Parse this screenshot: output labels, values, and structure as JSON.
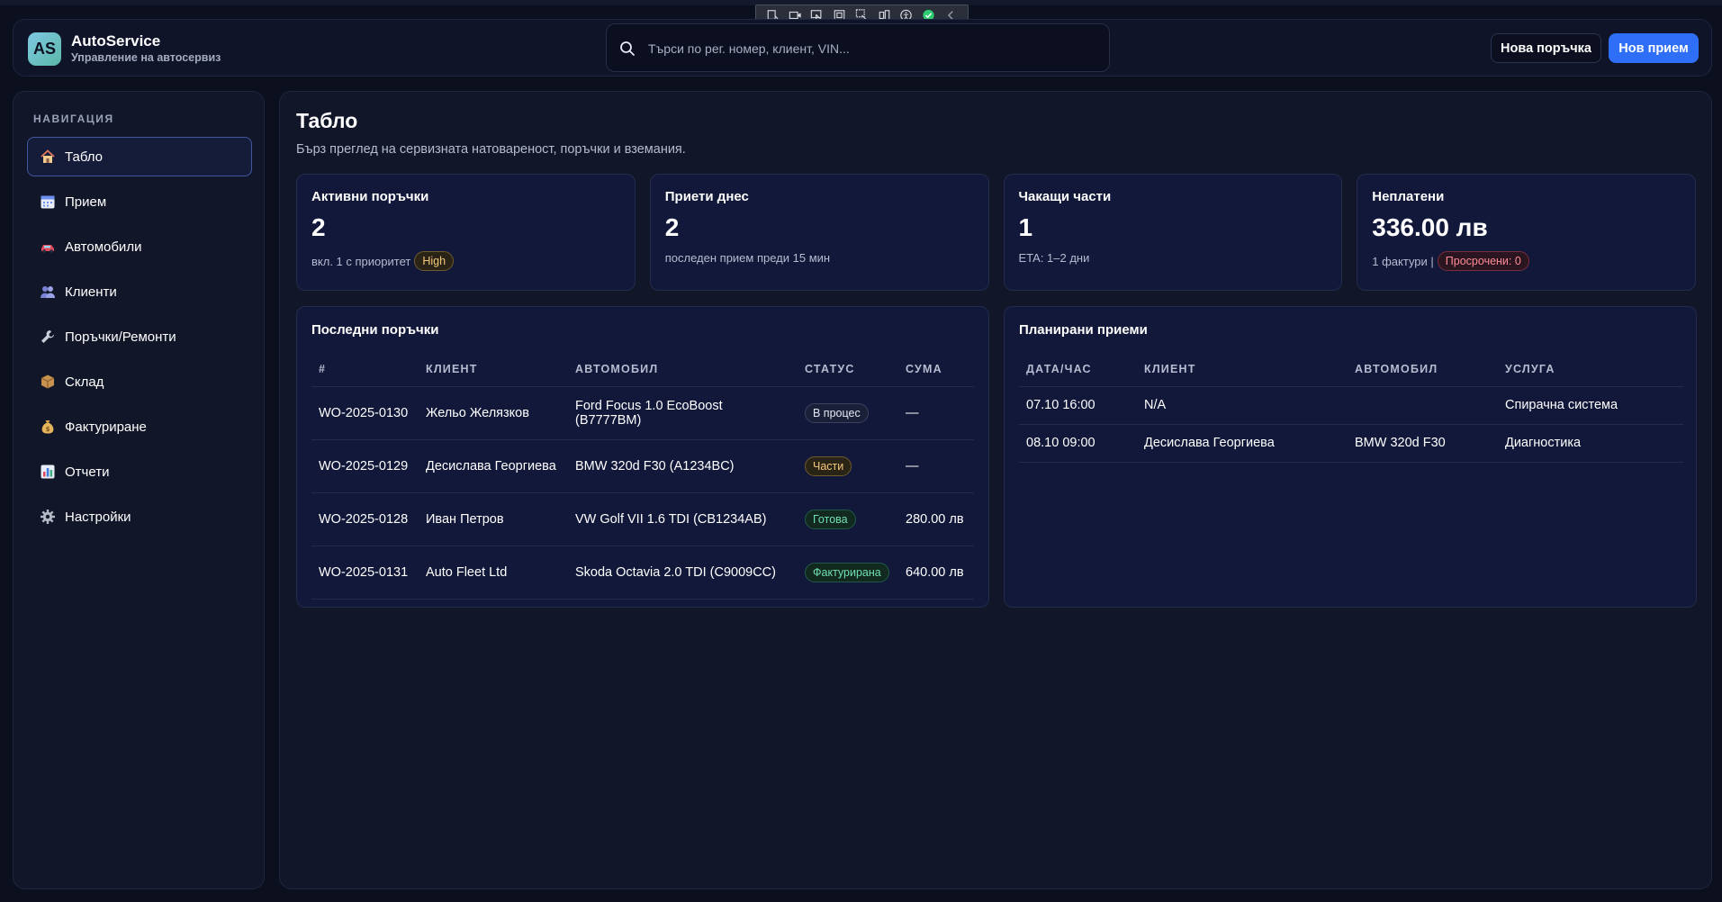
{
  "header": {
    "logo_text": "AS",
    "brand_title": "AutoService",
    "brand_subtitle": "Управление на автосервиз",
    "search_placeholder": "Търси по рег. номер, клиент, VIN...",
    "new_order_label": "Нова поръчка",
    "new_intake_label": "Нов прием",
    "accent_color": "#2f6ef7"
  },
  "sidebar": {
    "heading": "НАВИГАЦИЯ",
    "items": [
      {
        "label": "Табло",
        "icon": "house-icon",
        "active": true
      },
      {
        "label": "Прием",
        "icon": "calendar-icon"
      },
      {
        "label": "Автомобили",
        "icon": "car-icon"
      },
      {
        "label": "Клиенти",
        "icon": "people-icon"
      },
      {
        "label": "Поръчки/Ремонти",
        "icon": "wrench-icon"
      },
      {
        "label": "Склад",
        "icon": "package-icon"
      },
      {
        "label": "Фактуриране",
        "icon": "money-bag-icon"
      },
      {
        "label": "Отчети",
        "icon": "bar-chart-icon"
      },
      {
        "label": "Настройки",
        "icon": "gear-icon"
      }
    ]
  },
  "main": {
    "title": "Табло",
    "subtitle": "Бърз преглед на сервизната натовареност, поръчки и вземания.",
    "cards": [
      {
        "title": "Активни поръчки",
        "value": "2",
        "sub": "вкл. 1 с приоритет",
        "badge": "High"
      },
      {
        "title": "Приети днес",
        "value": "2",
        "sub": "последен прием преди 15 мин"
      },
      {
        "title": "Чакащи части",
        "value": "1",
        "sub": "ETA: 1–2 дни"
      },
      {
        "title": "Неплатени",
        "value": "336.00 лв",
        "sub": "1 фактури |",
        "badge": "Просрочени: 0"
      }
    ],
    "recent_orders": {
      "title": "Последни поръчки",
      "columns": [
        "#",
        "КЛИЕНТ",
        "АВТОМОБИЛ",
        "СТАТУС",
        "СУМА"
      ],
      "rows": [
        {
          "id": "WO-2025-0130",
          "client": "Жельо Желязков",
          "car": "Ford Focus 1.0 EcoBoost (B7777BM)",
          "status": "В процес",
          "amount": "—"
        },
        {
          "id": "WO-2025-0129",
          "client": "Десислава Георгиева",
          "car": "BMW 320d F30 (A1234BC)",
          "status": "Части",
          "amount": "—"
        },
        {
          "id": "WO-2025-0128",
          "client": "Иван Петров",
          "car": "VW Golf VII 1.6 TDI (CB1234AB)",
          "status": "Готова",
          "amount": "280.00 лв"
        },
        {
          "id": "WO-2025-0131",
          "client": "Auto Fleet Ltd",
          "car": "Skoda Octavia 2.0 TDI (C9009CC)",
          "status": "Фактурирана",
          "amount": "640.00 лв"
        }
      ]
    },
    "planned": {
      "title": "Планирани приеми",
      "columns": [
        "ДАТА/ЧАС",
        "КЛИЕНТ",
        "АВТОМОБИЛ",
        "УСЛУГА"
      ],
      "rows": [
        {
          "datetime": "07.10 16:00",
          "client": "N/A",
          "car": "",
          "service": "Спирачна система"
        },
        {
          "datetime": "08.10 09:00",
          "client": "Десислава Георгиева",
          "car": "BMW 320d F30",
          "service": "Диагностика"
        }
      ]
    }
  }
}
